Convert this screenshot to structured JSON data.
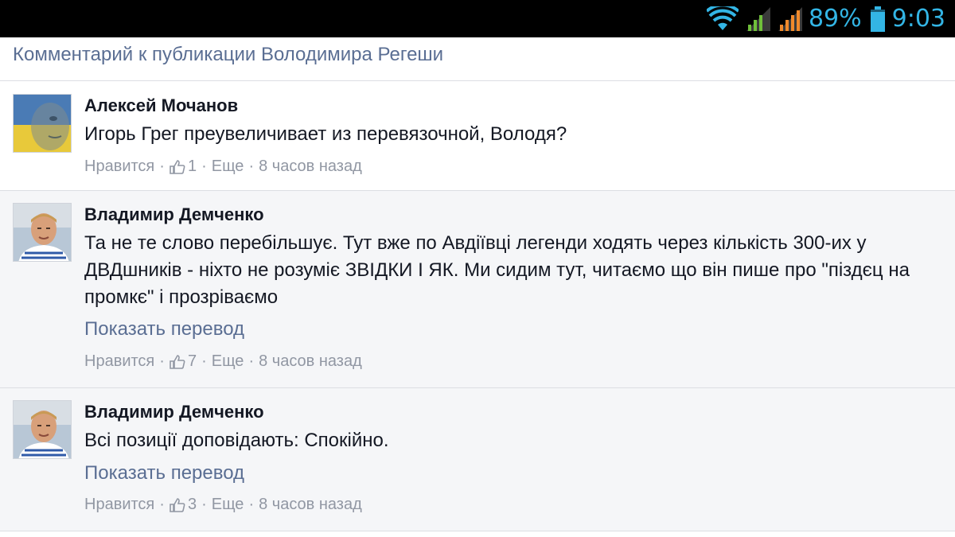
{
  "status_bar": {
    "icons": [
      "wifi-icon",
      "signal-icon",
      "signal-icon-2",
      "battery-icon"
    ],
    "battery_percent": "89%",
    "time": "9:03",
    "accent_color": "#33b5e5"
  },
  "post": {
    "title": "Комментарий к публикации Володимира Регеши"
  },
  "comments": [
    {
      "author": "Алексей Мочанов",
      "text": "Игорь Грег преувеличивает из перевязочной, Володя?",
      "like_label": "Нравится",
      "likes": "1",
      "more_label": "Еще",
      "time": "8 часов назад"
    },
    {
      "author": "Владимир Демченко",
      "text": "Та не те слово перебільшує. Тут вже по Авдіївці легенди ходять через кількість 300-их у ДВДшників - ніхто не розуміє ЗВІДКИ І ЯК. Ми сидим тут, читаємо що він пише про \"піздєц на промкє\" і прозріваємо",
      "translate_label": "Показать перевод",
      "like_label": "Нравится",
      "likes": "7",
      "more_label": "Еще",
      "time": "8 часов назад"
    },
    {
      "author": "Владимир Демченко",
      "text": "Всі позиції доповідають: Спокійно.",
      "translate_label": "Показать перевод",
      "like_label": "Нравится",
      "likes": "3",
      "more_label": "Еще",
      "time": "8 часов назад"
    }
  ],
  "colors": {
    "link": "#5a6e93",
    "meta": "#9197a3",
    "text": "#141823",
    "alt_background": "#f5f6f8"
  }
}
